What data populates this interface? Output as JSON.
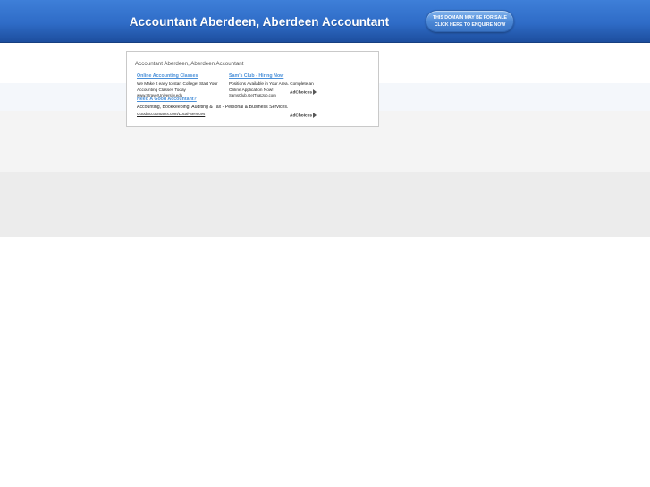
{
  "header": {
    "title": "Accountant Aberdeen, Aberdeen Accountant",
    "sale_line1": "THIS DOMAIN MAY BE FOR SALE",
    "sale_line2": "CLICK HERE TO ENQUIRE NOW"
  },
  "adbox": {
    "title": "Accountant Aberdeen, Aberdeen Accountant",
    "ads": [
      {
        "headline": "Online Accounting Classes",
        "line1": "We Make it easy to start College! Start Your",
        "line2": "Accounting Classes Today",
        "url": "www.StrayerUniversity.edu"
      },
      {
        "headline": "Sam's Club - Hiring Now",
        "line1": "Positions Available in Your Area. Complete an",
        "line2": "Online Application Now!",
        "url": "SamsClub.GetThatJob.com"
      },
      {
        "headline": "Need A Good Accountant?",
        "line1": "Accounting, Bookkeeping, Auditing & Tax - Personal & Business Services.",
        "url": "GoodAccountants.com/Local-Services"
      }
    ],
    "adchoices_label": "AdChoices"
  }
}
